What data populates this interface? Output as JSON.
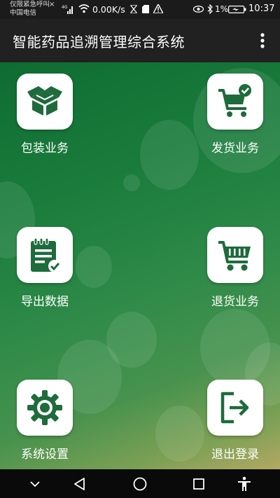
{
  "status_bar": {
    "carrier_line1": "仅限紧急呼叫",
    "carrier_line2": "中国电信",
    "close_glyph": "×",
    "network_speed": "0.00K/s",
    "battery_percent": "1%",
    "time": "10:37"
  },
  "app_bar": {
    "title": "智能药品追溯管理综合系统",
    "menu_icon": "more-vert-icon"
  },
  "tiles": [
    {
      "label": "包装业务",
      "icon": "package-box-icon"
    },
    {
      "label": "发货业务",
      "icon": "cart-check-icon"
    },
    {
      "label": "导出数据",
      "icon": "clipboard-export-icon"
    },
    {
      "label": "退货业务",
      "icon": "cart-return-icon"
    },
    {
      "label": "系统设置",
      "icon": "gear-icon"
    },
    {
      "label": "退出登录",
      "icon": "logout-icon"
    }
  ],
  "colors": {
    "icon_green": "#1e6b3c",
    "app_bar": "#212121",
    "status_bar": "#1b1b1b"
  },
  "nav_bar": {
    "icons": [
      "chevron-down-icon",
      "back-triangle-icon",
      "home-circle-icon",
      "recents-square-icon",
      "accessibility-icon"
    ]
  }
}
